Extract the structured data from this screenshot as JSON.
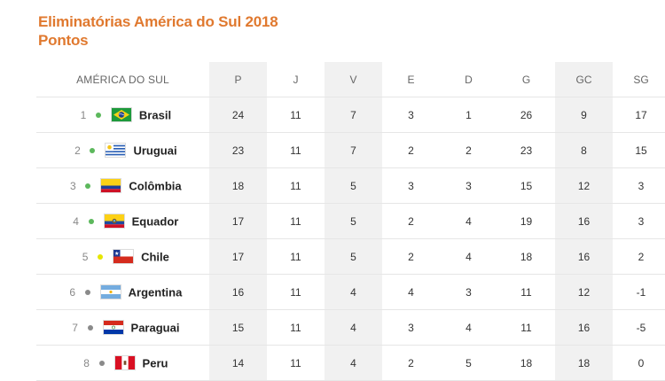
{
  "title": {
    "line1": "Eliminatórias América do Sul 2018",
    "line2": "Pontos"
  },
  "colors": {
    "title": "#e0792f",
    "qualified_dot": "#5cb85c",
    "playoff_dot": "#e6e600",
    "out_dot": "#8a8a8a",
    "shaded_column": "#f1f1f1"
  },
  "table": {
    "group_label": "AMÉRICA DO SUL",
    "columns": [
      "P",
      "J",
      "V",
      "E",
      "D",
      "G",
      "GC",
      "SG"
    ],
    "rows": [
      {
        "pos": "1",
        "status": "qualified",
        "flag": "brazil-flag-icon",
        "team": "Brasil",
        "P": "24",
        "J": "11",
        "V": "7",
        "E": "3",
        "D": "1",
        "G": "26",
        "GC": "9",
        "SG": "17"
      },
      {
        "pos": "2",
        "status": "qualified",
        "flag": "uruguay-flag-icon",
        "team": "Uruguai",
        "P": "23",
        "J": "11",
        "V": "7",
        "E": "2",
        "D": "2",
        "G": "23",
        "GC": "8",
        "SG": "15"
      },
      {
        "pos": "3",
        "status": "qualified",
        "flag": "colombia-flag-icon",
        "team": "Colômbia",
        "P": "18",
        "J": "11",
        "V": "5",
        "E": "3",
        "D": "3",
        "G": "15",
        "GC": "12",
        "SG": "3"
      },
      {
        "pos": "4",
        "status": "qualified",
        "flag": "ecuador-flag-icon",
        "team": "Equador",
        "P": "17",
        "J": "11",
        "V": "5",
        "E": "2",
        "D": "4",
        "G": "19",
        "GC": "16",
        "SG": "3"
      },
      {
        "pos": "5",
        "status": "playoff",
        "flag": "chile-flag-icon",
        "team": "Chile",
        "P": "17",
        "J": "11",
        "V": "5",
        "E": "2",
        "D": "4",
        "G": "18",
        "GC": "16",
        "SG": "2"
      },
      {
        "pos": "6",
        "status": "out",
        "flag": "argentina-flag-icon",
        "team": "Argentina",
        "P": "16",
        "J": "11",
        "V": "4",
        "E": "4",
        "D": "3",
        "G": "11",
        "GC": "12",
        "SG": "-1"
      },
      {
        "pos": "7",
        "status": "out",
        "flag": "paraguay-flag-icon",
        "team": "Paraguai",
        "P": "15",
        "J": "11",
        "V": "4",
        "E": "3",
        "D": "4",
        "G": "11",
        "GC": "16",
        "SG": "-5"
      },
      {
        "pos": "8",
        "status": "out",
        "flag": "peru-flag-icon",
        "team": "Peru",
        "P": "14",
        "J": "11",
        "V": "4",
        "E": "2",
        "D": "5",
        "G": "18",
        "GC": "18",
        "SG": "0"
      }
    ]
  }
}
